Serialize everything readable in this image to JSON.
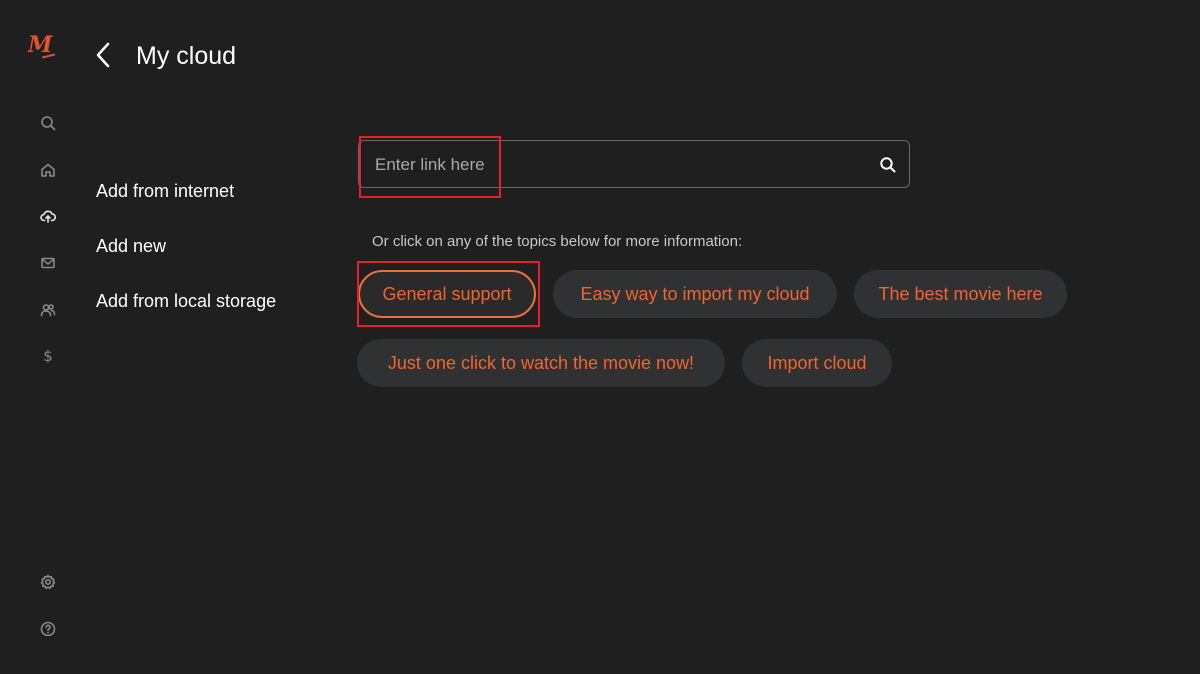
{
  "app": {
    "logo_text": "M",
    "accent_color": "#f2642e"
  },
  "header": {
    "title": "My cloud",
    "back_icon": "chevron-left-icon"
  },
  "rail": {
    "icons": [
      "search-icon",
      "home-icon",
      "cloud-upload-icon",
      "mail-icon",
      "users-icon",
      "dollar-icon",
      "gear-icon",
      "help-icon"
    ],
    "dollar_glyph": "$"
  },
  "menu": {
    "items": [
      {
        "label": "Add from internet"
      },
      {
        "label": "Add new"
      },
      {
        "label": "Add from local storage"
      }
    ]
  },
  "search": {
    "placeholder": "Enter link here",
    "value": ""
  },
  "hint": "Or click on any of the topics below for more information:",
  "topics": [
    {
      "label": "General support"
    },
    {
      "label": "Easy way to import my cloud"
    },
    {
      "label": "The best movie here"
    },
    {
      "label": "Just one click to watch the movie now!"
    },
    {
      "label": "Import cloud"
    }
  ]
}
